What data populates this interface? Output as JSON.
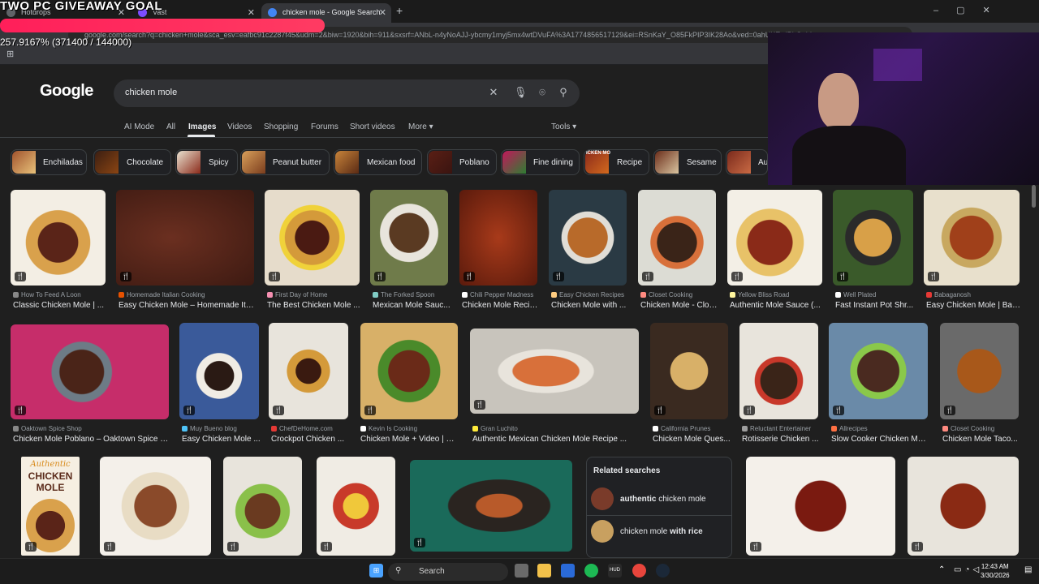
{
  "overlay": {
    "giveaway_text": "TWO PC GIVEAWAY GOAL",
    "goal_progress_text": "257.9167% (371400 / 144000)"
  },
  "browser": {
    "tabs": [
      {
        "label": "Hotdrops"
      },
      {
        "label": "Vast"
      },
      {
        "label": "chicken mole - Google Search"
      }
    ],
    "new_tab": "+",
    "url": "google.com/search?q=chicken+mole&sca_esv=eafbc91c2287f45&udm=2&biw=1920&bih=911&sxsrf=ANbL-n4yNoAJJ-ybcmy1myj5mx4wtDVuFA%3A1774856517129&ei=RSnKaY_O85FkPIP3IK28Ao&ved=0ahUKEwiPbOahI"
  },
  "google": {
    "logo": "Google",
    "query": "chicken mole",
    "nav": [
      "AI Mode",
      "All",
      "Images",
      "Videos",
      "Shopping",
      "Forums",
      "Short videos",
      "More",
      "Tools"
    ],
    "active_nav": "Images",
    "chips": [
      "Enchiladas",
      "Chocolate",
      "Spicy",
      "Peanut butter",
      "Mexican food",
      "Poblano",
      "Fine dining",
      "Recipe",
      "Sesame",
      "Au"
    ],
    "row1": [
      {
        "source": "How To Feed A Loon",
        "title": "Classic Chicken Mole | ..."
      },
      {
        "source": "Homemade Italian Cooking",
        "title": "Easy Chicken Mole – Homemade Ital..."
      },
      {
        "source": "First Day of Home",
        "title": "The Best Chicken Mole ..."
      },
      {
        "source": "The Forked Spoon",
        "title": "Mexican Mole Sauc..."
      },
      {
        "source": "Chili Pepper Madness",
        "title": "Chicken Mole Recip..."
      },
      {
        "source": "Easy Chicken Recipes",
        "title": "Chicken Mole with ..."
      },
      {
        "source": "Closet Cooking",
        "title": "Chicken Mole - Clos..."
      },
      {
        "source": "Yellow Bliss Road",
        "title": "Authentic Mole Sauce (..."
      },
      {
        "source": "Well Plated",
        "title": "Fast Instant Pot Shr..."
      },
      {
        "source": "Babaganosh",
        "title": "Easy Chicken Mole | Bab..."
      }
    ],
    "row2": [
      {
        "source": "Oaktown Spice Shop",
        "title": "Chicken Mole Poblano – Oaktown Spice S..."
      },
      {
        "source": "Muy Bueno blog",
        "title": "Easy Chicken Mole ..."
      },
      {
        "source": "ChefDeHome.com",
        "title": "Crockpot Chicken ..."
      },
      {
        "source": "Kevin Is Cooking",
        "title": "Chicken Mole + Video | Ke..."
      },
      {
        "source": "Gran Luchito",
        "title": "Authentic Mexican Chicken Mole Recipe ..."
      },
      {
        "source": "California Prunes",
        "title": "Chicken Mole Ques..."
      },
      {
        "source": "Reluctant Entertainer",
        "title": "Rotisserie Chicken ..."
      },
      {
        "source": "Allrecipes",
        "title": "Slow Cooker Chicken Mol..."
      },
      {
        "source": "Closet Cooking",
        "title": "Chicken Mole Taco..."
      }
    ],
    "book_cover": {
      "line1": "Authentic",
      "line2": "CHICKEN",
      "line3": "MOLE"
    },
    "related": {
      "heading": "Related searches",
      "items": [
        {
          "bold": "authentic",
          "rest": " chicken mole"
        },
        {
          "plain": "chicken mole ",
          "bold": "with rice"
        }
      ]
    },
    "chip_recipe_overlay": "ICKEN MO"
  },
  "taskbar": {
    "search": "Search",
    "time": "12:43 AM",
    "date": "3/30/2026"
  },
  "colors": {
    "background": "#1f1f1f",
    "goal_bar": "#ff2d5e",
    "search_box": "#303134"
  }
}
